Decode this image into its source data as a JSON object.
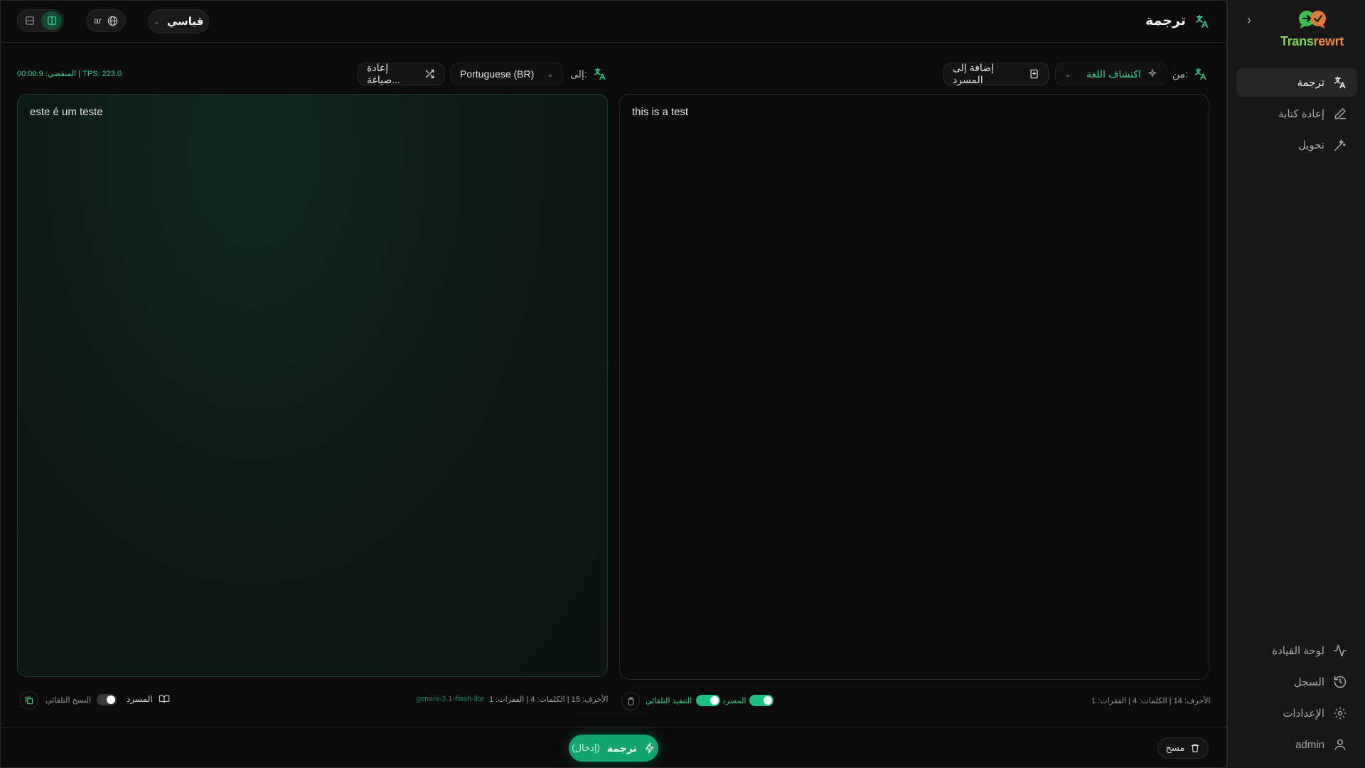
{
  "header": {
    "title": "ترجمة",
    "mode": "قياسي",
    "ui_language": "ar"
  },
  "sidebar": {
    "brand_a": "Trans",
    "brand_b": "rewrt",
    "items": [
      {
        "label": "ترجمة",
        "icon": "translate-icon",
        "active": true
      },
      {
        "label": "إعادة كتابة",
        "icon": "pen-icon",
        "active": false
      },
      {
        "label": "تحويل",
        "icon": "magic-wand-icon",
        "active": false
      }
    ],
    "bottom_items": [
      {
        "label": "لوحة القيادة",
        "icon": "activity-icon"
      },
      {
        "label": "السجل",
        "icon": "history-icon"
      },
      {
        "label": "الإعدادات",
        "icon": "gear-icon"
      },
      {
        "label": "admin",
        "icon": "user-icon"
      }
    ]
  },
  "source": {
    "from_label": "من:",
    "language": "اكتشاف اللغة",
    "add_to_glossary": "إضافة إلى المسرد",
    "text": "this is a test",
    "stats": "الأحرف: 14 | الكلمات: 4 | الفقرات: 1",
    "glossary_toggle_label": "المسرد",
    "auto_run_label": "التنفيذ التلقائي"
  },
  "target": {
    "to_label": "إلى:",
    "language": "Portuguese (BR)",
    "rephrase_label": "إعادة صياغة...",
    "meta": "المنقضي: 00:00.9 | TPS: 223.0",
    "text": "este é um teste",
    "stats": "الأحرف: 15 | الكلمات: 4 | الفقرات: 1",
    "model": "gemini-3.1-flash-lite",
    "glossary_label": "المسرد",
    "auto_copy_label": "النسخ التلقائي"
  },
  "actions": {
    "translate": "ترجمة",
    "translate_hint": "(إدخال)",
    "clear": "مسح"
  },
  "colors": {
    "accent": "#2fd38f",
    "button": "#12a56d",
    "brand_green": "#7dd34a",
    "brand_orange": "#f08a3a"
  }
}
